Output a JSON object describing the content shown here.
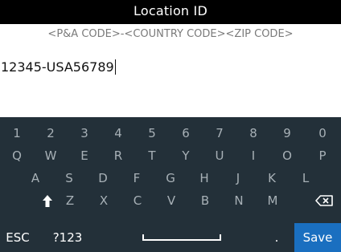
{
  "title": "Location ID",
  "hint": "<P&A CODE>-<COUNTRY CODE><ZIP CODE>",
  "entry": {
    "value": "12345-USA56789"
  },
  "keyboard": {
    "numbers": [
      "1",
      "2",
      "3",
      "4",
      "5",
      "6",
      "7",
      "8",
      "9",
      "0"
    ],
    "row_q": [
      "Q",
      "W",
      "E",
      "R",
      "T",
      "Y",
      "U",
      "I",
      "O",
      "P"
    ],
    "row_a": [
      "A",
      "S",
      "D",
      "F",
      "G",
      "H",
      "J",
      "K",
      "L"
    ],
    "row_z": [
      "Z",
      "X",
      "C",
      "V",
      "B",
      "N",
      "M"
    ],
    "esc_label": "ESC",
    "symbols_label": "?123",
    "period_label": ".",
    "save_label": "Save",
    "shift_icon": "shift-arrow-icon",
    "backspace_icon": "backspace-icon",
    "space_icon": "space-bar-icon"
  },
  "colors": {
    "title_bar": "#000000",
    "keyboard_bg": "#233039",
    "key_text": "#a7b0b6",
    "save_bg": "#1a6fc0"
  }
}
